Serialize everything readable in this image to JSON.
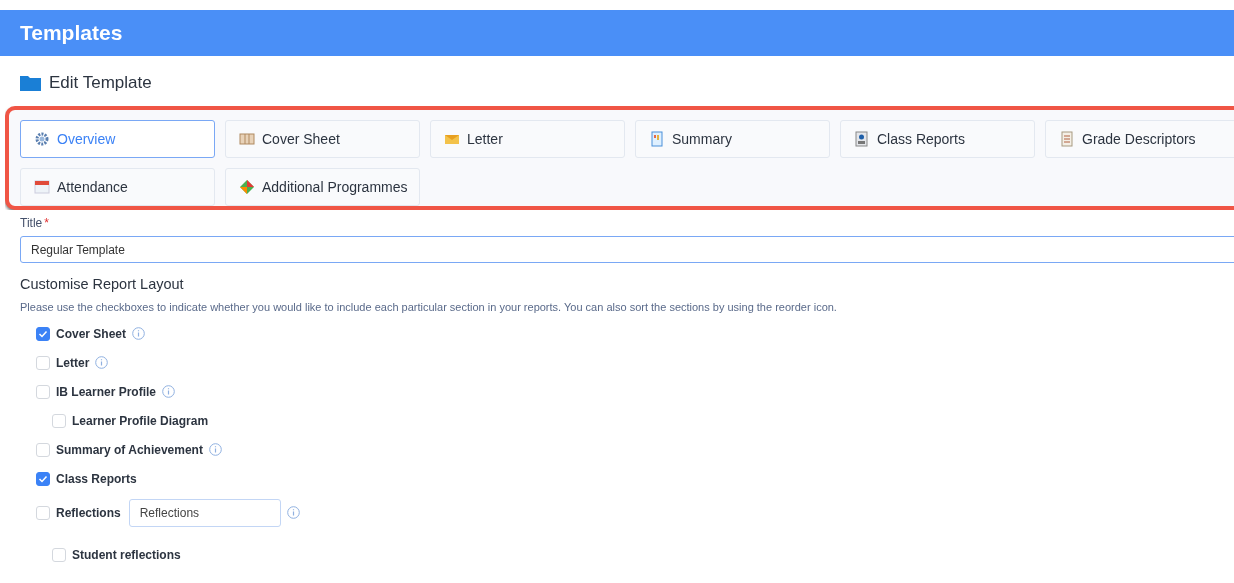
{
  "header": {
    "title": "Templates"
  },
  "page": {
    "title": "Edit Template"
  },
  "tabs": [
    {
      "label": "Overview",
      "selected": true
    },
    {
      "label": "Cover Sheet",
      "selected": false
    },
    {
      "label": "Letter",
      "selected": false
    },
    {
      "label": "Summary",
      "selected": false
    },
    {
      "label": "Class Reports",
      "selected": false
    },
    {
      "label": "Grade Descriptors",
      "selected": false
    },
    {
      "label": "Attendance",
      "selected": false
    },
    {
      "label": "Additional Programmes",
      "selected": false
    }
  ],
  "title_field": {
    "label": "Title",
    "required_mark": "*",
    "value": "Regular Template"
  },
  "layout": {
    "heading": "Customise Report Layout",
    "help": "Please use the checkboxes to indicate whether you would like to include each particular section in your reports. You can also sort the sections by using the reorder icon.",
    "sections": [
      {
        "label": "Cover Sheet",
        "checked": true,
        "info": true
      },
      {
        "label": "Letter",
        "checked": false,
        "info": true
      },
      {
        "label": "IB Learner Profile",
        "checked": false,
        "info": true,
        "children": [
          {
            "label": "Learner Profile Diagram",
            "checked": false,
            "info": false
          }
        ]
      },
      {
        "label": "Summary of Achievement",
        "checked": false,
        "info": true
      },
      {
        "label": "Class Reports",
        "checked": true,
        "info": false
      },
      {
        "label": "Reflections",
        "checked": false,
        "info": true,
        "field_value": "Reflections",
        "children": [
          {
            "label": "Student reflections",
            "checked": false,
            "info": false
          }
        ]
      }
    ]
  }
}
